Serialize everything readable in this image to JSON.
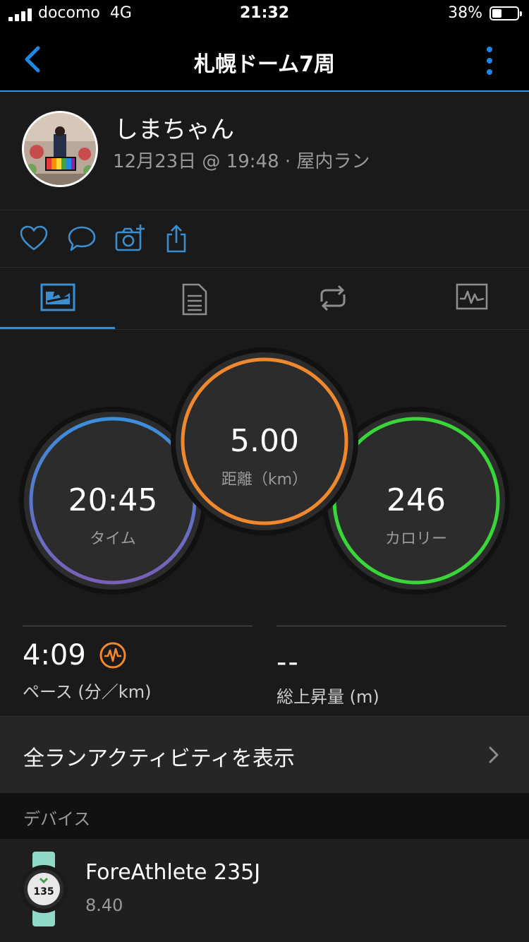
{
  "status_bar": {
    "carrier": "docomo",
    "network": "4G",
    "time": "21:32",
    "battery_percent": "38%",
    "battery_level": 0.38
  },
  "nav": {
    "title": "札幌ドーム7周",
    "back_icon": "chevron-left-icon",
    "menu_icon": "kebab-menu-icon"
  },
  "profile": {
    "name": "しまちゃん",
    "meta": "12月23日 @ 19:48 · 屋内ラン"
  },
  "actions": [
    "heart-icon",
    "comment-icon",
    "add-photo-icon",
    "share-icon"
  ],
  "tabs": [
    "summary-icon",
    "details-icon",
    "laps-icon",
    "chart-icon"
  ],
  "stats": {
    "time": {
      "value": "20:45",
      "label": "タイム"
    },
    "distance": {
      "value": "5.00",
      "label": "距離（km）"
    },
    "calories": {
      "value": "246",
      "label": "カロリー"
    },
    "pace": {
      "value": "4:09",
      "label": "ペース (分／km)"
    },
    "elevation": {
      "value": "--",
      "label": "総上昇量 (m)"
    }
  },
  "colors": {
    "accent": "#3b8fd0",
    "time_ring_start": "#3a8fdc",
    "time_ring_end": "#7a5fb8",
    "distance_ring": "#f0892e",
    "calories_ring": "#39d63a",
    "heart_rate_icon": "#f0892e"
  },
  "all_runs": {
    "label": "全ランアクティビティを表示"
  },
  "devices": {
    "header": "デバイス",
    "name": "ForeAthlete 235J",
    "version": "8.40"
  }
}
